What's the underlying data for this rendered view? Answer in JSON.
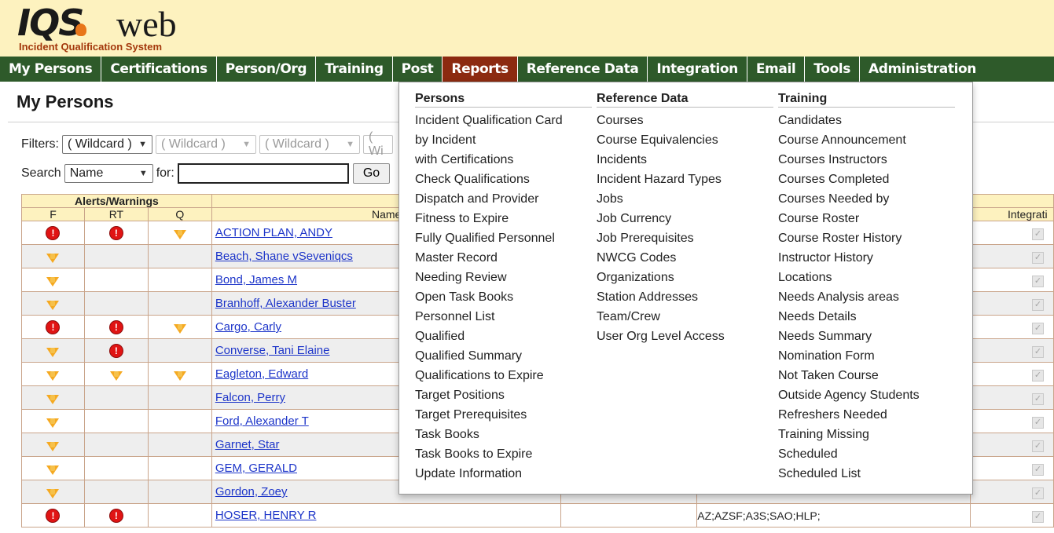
{
  "logo": {
    "brand": "IQS",
    "web": "web",
    "subtitle": "Incident Qualification System"
  },
  "nav": [
    "My Persons",
    "Certifications",
    "Person/Org",
    "Training",
    "Post",
    "Reports",
    "Reference Data",
    "Integration",
    "Email",
    "Tools",
    "Administration"
  ],
  "nav_active": "Reports",
  "page": {
    "title": "My Persons"
  },
  "filters": {
    "label": "Filters:",
    "selects": [
      "( Wildcard )",
      "( Wildcard )",
      "( Wildcard )",
      "( Wi"
    ]
  },
  "search": {
    "label": "Search",
    "field": "Name",
    "for_label": "for:",
    "value": "",
    "go": "Go"
  },
  "grid": {
    "group_header": "Alerts/Warnings",
    "columns": [
      "F",
      "RT",
      "Q",
      "Name",
      "Integrati"
    ],
    "rows": [
      {
        "name": "ACTION PLAN, ANDY",
        "f": "alert",
        "rt": "alert",
        "q": "warning",
        "extra": ""
      },
      {
        "name": "Beach, Shane vSeveniqcs",
        "f": "warning",
        "rt": "",
        "q": "",
        "extra": ""
      },
      {
        "name": "Bond, James M",
        "f": "warning",
        "rt": "",
        "q": "",
        "extra": ""
      },
      {
        "name": "Branhoff, Alexander Buster",
        "f": "warning",
        "rt": "",
        "q": "",
        "extra": ""
      },
      {
        "name": "Cargo, Carly",
        "f": "alert",
        "rt": "alert",
        "q": "warning",
        "extra": ""
      },
      {
        "name": "Converse, Tani Elaine",
        "f": "warning",
        "rt": "alert",
        "q": "",
        "extra": ""
      },
      {
        "name": "Eagleton, Edward",
        "f": "warning",
        "rt": "warning",
        "q": "warning",
        "extra": ""
      },
      {
        "name": "Falcon, Perry",
        "f": "warning",
        "rt": "",
        "q": "",
        "extra": ""
      },
      {
        "name": "Ford, Alexander T",
        "f": "warning",
        "rt": "",
        "q": "",
        "extra": ""
      },
      {
        "name": "Garnet, Star",
        "f": "warning",
        "rt": "",
        "q": "",
        "extra": ""
      },
      {
        "name": "GEM, GERALD",
        "f": "warning",
        "rt": "",
        "q": "",
        "extra": ""
      },
      {
        "name": "Gordon, Zoey",
        "f": "warning",
        "rt": "",
        "q": "",
        "extra": ""
      },
      {
        "name": "HOSER, HENRY R",
        "f": "alert",
        "rt": "alert",
        "q": "",
        "extra": "AZ;AZSF;A3S;SAO;HLP;"
      }
    ]
  },
  "reports_menu": {
    "persons": {
      "heading": "Persons",
      "items": [
        "Incident Qualification Card",
        "by Incident",
        "with Certifications",
        "Check Qualifications",
        "Dispatch and Provider",
        "Fitness to Expire",
        "Fully Qualified Personnel",
        "Master Record",
        "Needing Review",
        "Open Task Books",
        "Personnel List",
        "Qualified",
        "Qualified Summary",
        "Qualifications to Expire",
        "Target Positions",
        "Target Prerequisites",
        "Task Books",
        "Task Books to Expire",
        "Update Information"
      ]
    },
    "reference": {
      "heading": "Reference Data",
      "items": [
        "Courses",
        "Course Equivalencies",
        "Incidents",
        "Incident Hazard Types",
        "Jobs",
        "Job Currency",
        "Job Prerequisites",
        "NWCG Codes",
        "Organizations",
        "Station Addresses",
        "Team/Crew",
        "User Org Level Access"
      ]
    },
    "training": {
      "heading": "Training",
      "items": [
        "Candidates",
        "Course Announcement",
        "Courses Instructors",
        "Courses Completed",
        "Courses Needed by",
        "Course Roster",
        "Course Roster History",
        "Instructor History",
        "Locations",
        "Needs Analysis areas",
        "Needs Details",
        "Needs Summary",
        "Nomination Form",
        "Not Taken Course",
        "Outside Agency Students",
        "Refreshers Needed",
        "Training Missing",
        "Scheduled",
        "Scheduled List"
      ]
    }
  },
  "icons": {
    "alert": "alert-icon",
    "warning": "warning-icon",
    "checkbox": "checkbox-icon"
  },
  "colors": {
    "nav_bg": "#2e5a2a",
    "nav_active": "#8c2a10",
    "banner_bg": "#fdf2bf",
    "link": "#1d35c9",
    "alert": "#e01414",
    "warning": "#f5a921"
  }
}
